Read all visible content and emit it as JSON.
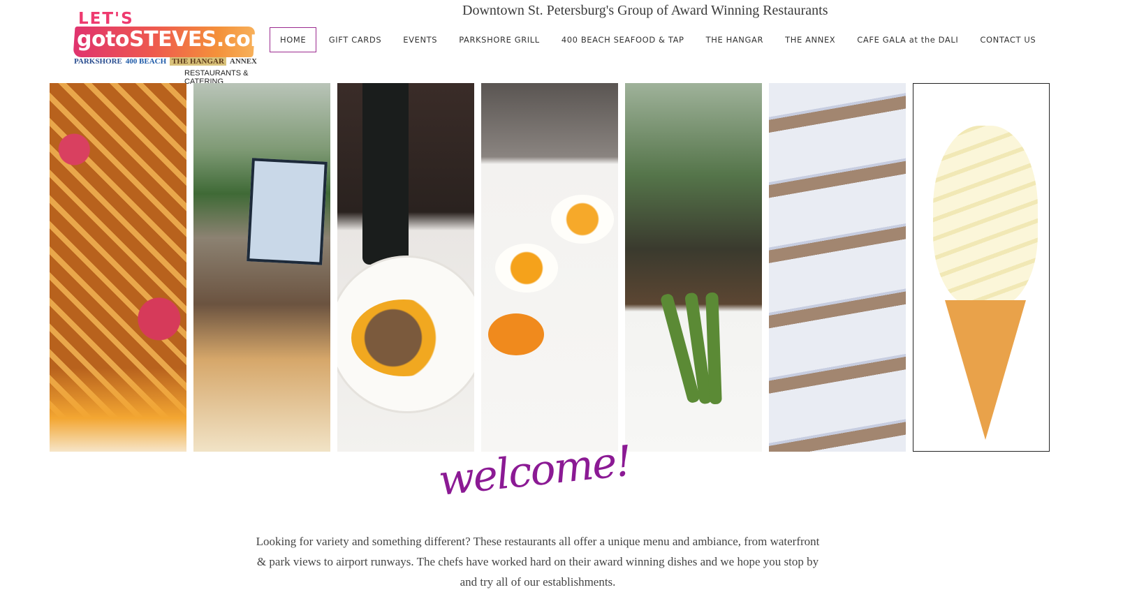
{
  "header": {
    "logo": {
      "lets": "LET'S",
      "wordmark": "gotoSTEVES.com",
      "brands": [
        "PARKSHORE",
        "400 BEACH",
        "THE HANGAR",
        "ANNEX"
      ],
      "tagline": "RESTAURANTS & CATERING"
    },
    "headline": "Downtown St. Petersburg's Group of Award Winning Restaurants"
  },
  "nav": {
    "items": [
      {
        "label": "HOME",
        "active": true
      },
      {
        "label": "GIFT CARDS"
      },
      {
        "label": "EVENTS"
      },
      {
        "label": "PARKSHORE GRILL"
      },
      {
        "label": "400 BEACH SEAFOOD & TAP"
      },
      {
        "label": "THE HANGAR"
      },
      {
        "label": "THE ANNEX"
      },
      {
        "label": "CAFE GALA at the DALI"
      },
      {
        "label": "CONTACT US"
      }
    ]
  },
  "main": {
    "welcome": "welcome!",
    "intro": "Looking for variety and something different? These restaurants all offer a unique menu and ambiance, from waterfront & park views to airport runways.  The chefs have worked hard on their award winning dishes and we hope you stop by and try all of our establishments."
  },
  "colors": {
    "accent": "#8b1a94",
    "nav_active_border": "#9b2a8f",
    "text": "#444444"
  }
}
